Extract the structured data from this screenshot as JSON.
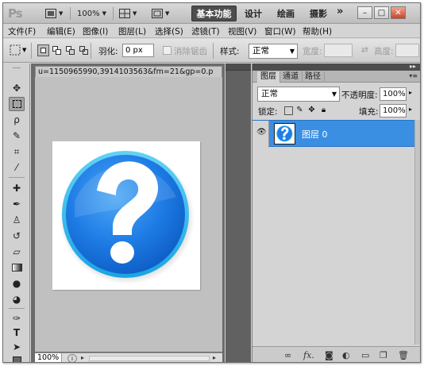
{
  "app": {
    "logo": "Ps",
    "zoom": "100%"
  },
  "workspace": {
    "active": "基本功能",
    "items": [
      "设计",
      "绘画",
      "摄影"
    ],
    "more": "»"
  },
  "window_controls": {
    "minimize": "–",
    "restore": "□",
    "close": "✕"
  },
  "menu": [
    "文件(F)",
    "编辑(E)",
    "图像(I)",
    "图层(L)",
    "选择(S)",
    "滤镜(T)",
    "视图(V)",
    "窗口(W)",
    "帮助(H)"
  ],
  "options": {
    "feather_label": "羽化:",
    "feather_value": "0 px",
    "antialias_label": "消除锯齿",
    "style_label": "样式:",
    "style_value": "正常",
    "width_label": "宽度:",
    "height_label": "高度:"
  },
  "document": {
    "tab_title": "u=1150965990,3914103563&fm=21&gp=0.p",
    "zoom": "100%",
    "image_icon": "question-mark-icon",
    "colors": {
      "circle_outer": "#3fbef0",
      "circle_inner": "#1f7de6",
      "glyph": "#ffffff"
    }
  },
  "layers_panel": {
    "tabs": [
      "图层",
      "通道",
      "路径"
    ],
    "blend_mode": "正常",
    "opacity_label": "不透明度:",
    "opacity_value": "100%",
    "lock_label": "锁定:",
    "fill_label": "填充:",
    "fill_value": "100%",
    "layers": [
      {
        "name": "图层 0",
        "visible": true,
        "selected": true
      }
    ],
    "selection_color": "#3a8fe3"
  }
}
